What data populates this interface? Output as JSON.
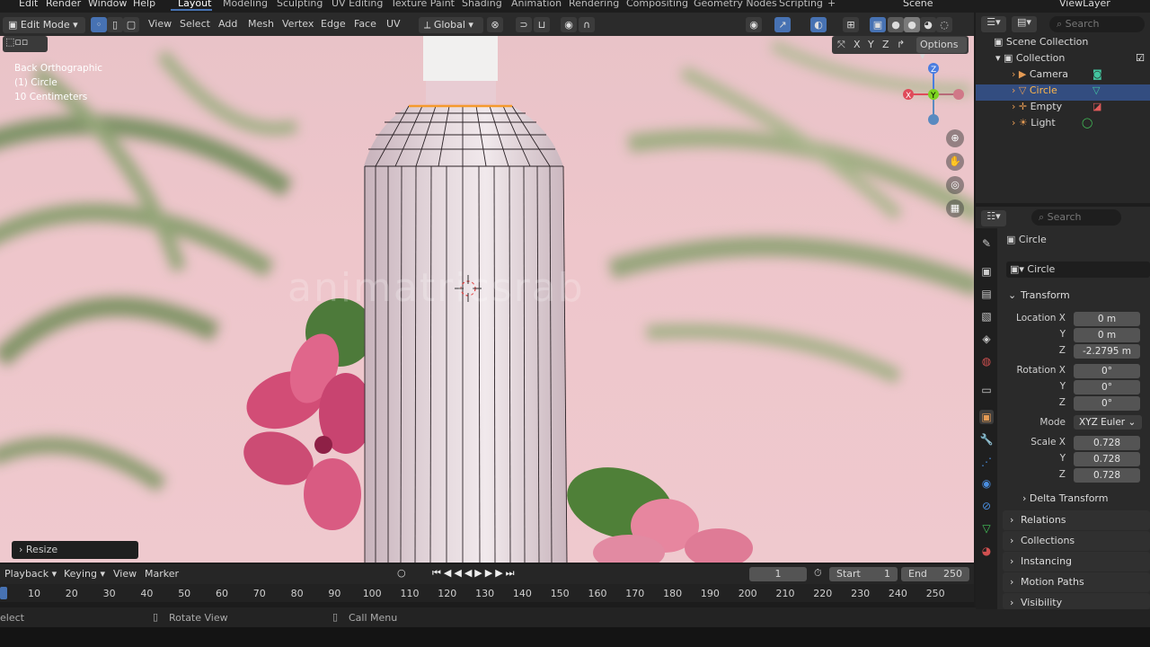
{
  "menu": {
    "edit": "Edit",
    "render": "Render",
    "window": "Window",
    "help": "Help"
  },
  "workspaces": [
    "Layout",
    "Modeling",
    "Sculpting",
    "UV Editing",
    "Texture Paint",
    "Shading",
    "Animation",
    "Rendering",
    "Compositing",
    "Geometry Nodes",
    "Scripting"
  ],
  "scene": "Scene",
  "view_layer": "ViewLayer",
  "header": {
    "mode": "Edit Mode",
    "view": "View",
    "select": "Select",
    "add": "Add",
    "mesh": "Mesh",
    "vertex": "Vertex",
    "edge": "Edge",
    "face": "Face",
    "uv": "UV",
    "orientation": "Global",
    "options": "Options"
  },
  "axes": {
    "x": "X",
    "y": "Y",
    "z": "Z"
  },
  "viewport": {
    "view_name": "Back Orthographic",
    "object": "(1) Circle",
    "scale": "10 Centimeters",
    "watermark": "animatricsrab",
    "last_op": "Resize"
  },
  "outliner": {
    "search_placeholder": "Search",
    "scene_collection": "Scene Collection",
    "collection": "Collection",
    "items": [
      "Camera",
      "Circle",
      "Empty",
      "Light"
    ]
  },
  "properties": {
    "search_placeholder": "Search",
    "object_name": "Circle",
    "object_field": "Circle",
    "transform": "Transform",
    "location_label": "Location X",
    "location": [
      "0 m",
      "0 m",
      "-2.2795 m"
    ],
    "rotation_label": "Rotation X",
    "rotation": [
      "0°",
      "0°",
      "0°"
    ],
    "mode_label": "Mode",
    "mode_value": "XYZ Euler",
    "scale_label": "Scale X",
    "scale": [
      "0.728",
      "0.728",
      "0.728"
    ],
    "y": "Y",
    "z": "Z",
    "delta": "Delta Transform",
    "relations": "Relations",
    "collections": "Collections",
    "instancing": "Instancing",
    "motion_paths": "Motion Paths",
    "visibility": "Visibility"
  },
  "timeline": {
    "playback": "Playback",
    "keying": "Keying",
    "view": "View",
    "marker": "Marker",
    "current": "1",
    "start_label": "Start",
    "start": "1",
    "end_label": "End",
    "end": "250",
    "ticks": [
      "10",
      "20",
      "30",
      "40",
      "50",
      "60",
      "70",
      "80",
      "90",
      "100",
      "110",
      "120",
      "130",
      "140",
      "150",
      "160",
      "170",
      "180",
      "190",
      "200",
      "210",
      "220",
      "230",
      "240",
      "250"
    ]
  },
  "status": {
    "select": "elect",
    "rotate": "Rotate View",
    "call_menu": "Call Menu"
  }
}
